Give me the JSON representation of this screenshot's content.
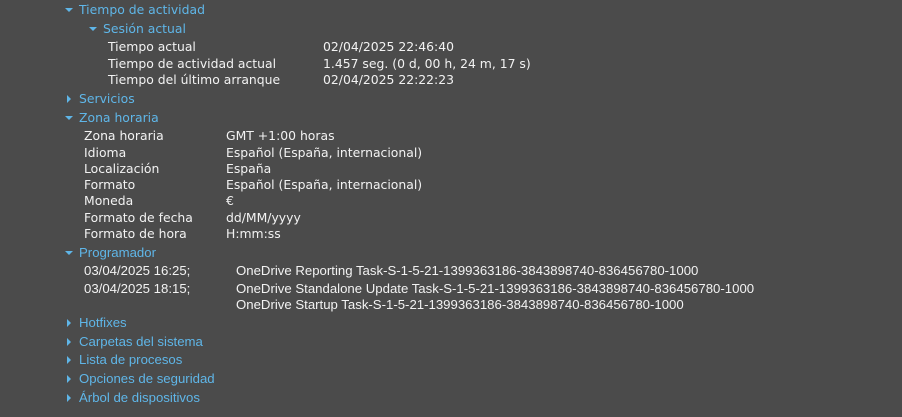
{
  "uptime": {
    "title": "Tiempo de actividad",
    "session": {
      "title": "Sesión actual",
      "rows": [
        {
          "label": "Tiempo actual",
          "value": "02/04/2025 22:46:40"
        },
        {
          "label": "Tiempo de actividad actual",
          "value": "1.457 seg. (0 d, 00 h, 24 m, 17 s)"
        },
        {
          "label": "Tiempo del último arranque",
          "value": "02/04/2025 22:22:23"
        }
      ]
    }
  },
  "services": {
    "title": "Servicios"
  },
  "timezone": {
    "title": "Zona horaria",
    "rows": [
      {
        "label": "Zona horaria",
        "value": "GMT +1:00 horas"
      },
      {
        "label": "Idioma",
        "value": "Español (España, internacional)"
      },
      {
        "label": "Localización",
        "value": "España"
      },
      {
        "label": "Formato",
        "value": "Español (España, internacional)"
      },
      {
        "label": "Moneda",
        "value": "€"
      },
      {
        "label": "Formato de fecha",
        "value": "dd/MM/yyyy"
      },
      {
        "label": "Formato de hora",
        "value": "H:mm:ss"
      }
    ]
  },
  "scheduler": {
    "title": "Programador",
    "rows": [
      {
        "date": "03/04/2025 16:25;",
        "task": "OneDrive Reporting Task-S-1-5-21-1399363186-3843898740-836456780-1000"
      },
      {
        "date": "03/04/2025 18:15;",
        "task": "OneDrive Standalone Update Task-S-1-5-21-1399363186-3843898740-836456780-1000"
      },
      {
        "date": "",
        "task": "OneDrive Startup Task-S-1-5-21-1399363186-3843898740-836456780-1000"
      }
    ]
  },
  "collapsed": [
    "Hotfixes",
    "Carpetas del sistema",
    "Lista de procesos",
    "Opciones de seguridad",
    "Árbol de dispositivos"
  ]
}
